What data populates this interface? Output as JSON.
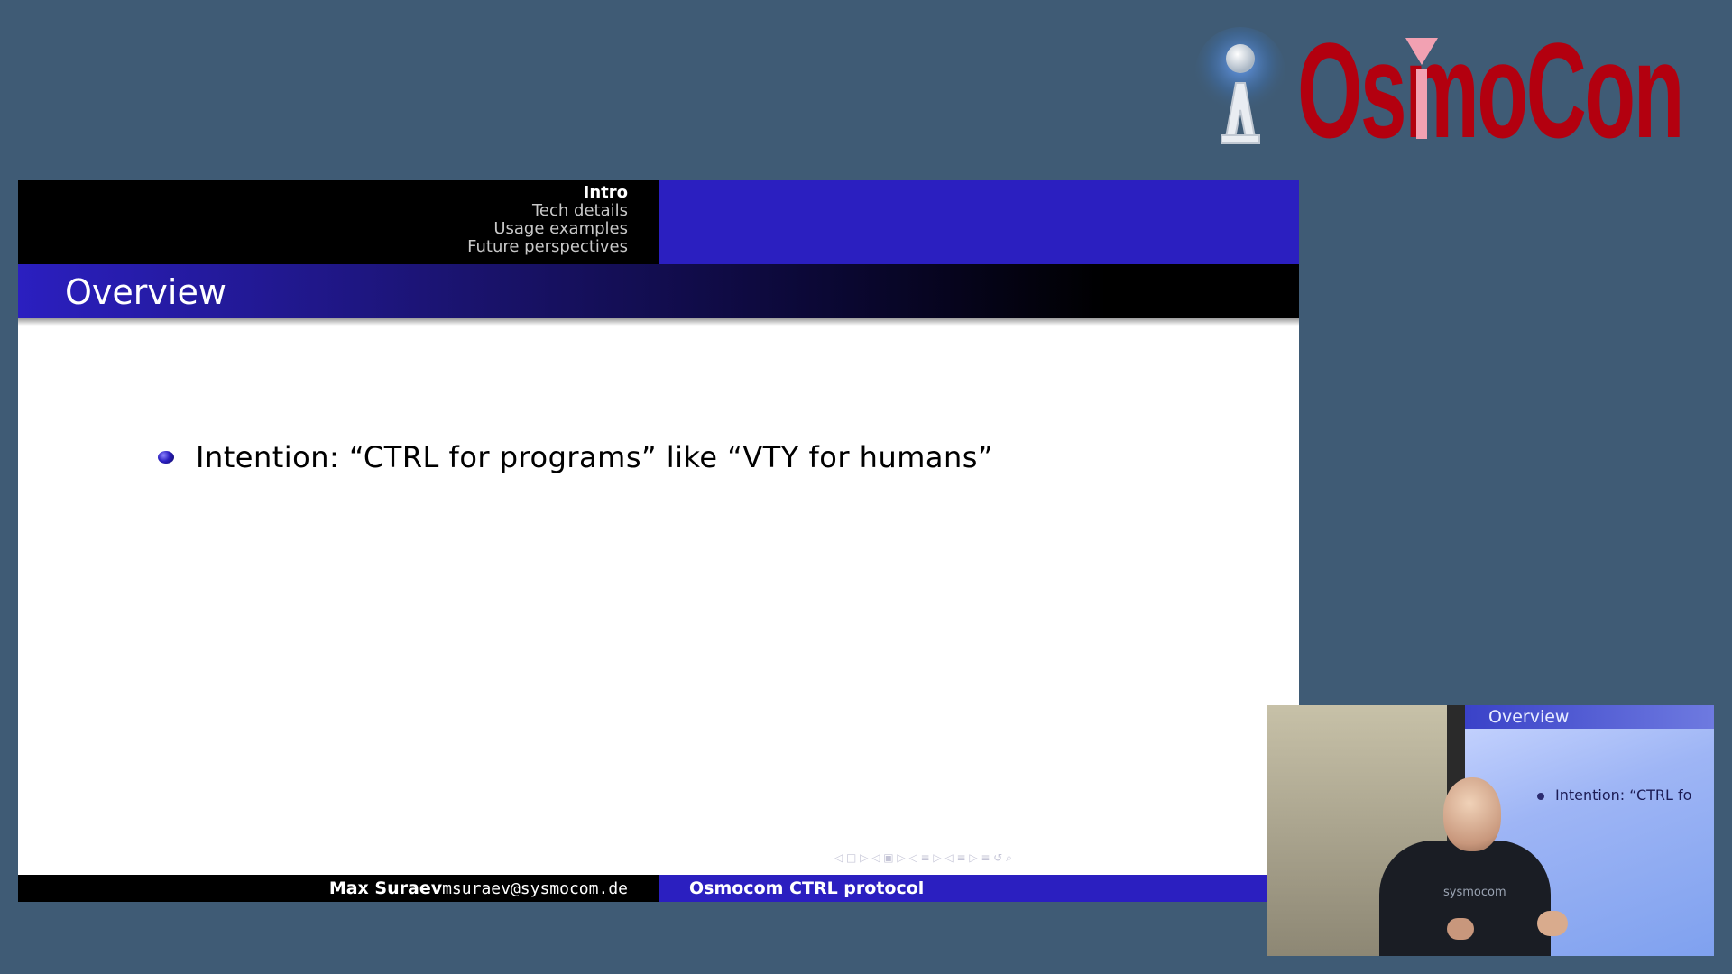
{
  "logo": {
    "text": "OsmoCon",
    "icon": "antenna-tower-icon",
    "color": "#b3000f"
  },
  "slide": {
    "sections": {
      "current": "Intro",
      "others": [
        "Tech details",
        "Usage examples",
        "Future perspectives"
      ]
    },
    "frame_title": "Overview",
    "bullets": [
      "Intention: “CTRL for programs” like “VTY for humans”"
    ],
    "nav_symbols": "◁ □ ▷   ◁ ▣ ▷   ◁ ≡ ▷   ◁ ≡ ▷   ≡   ↺ ⌕",
    "footer": {
      "author_name": "Max Suraev",
      "author_email": "msuraev@sysmocom.de",
      "talk_title": "Osmocom CTRL protocol"
    },
    "colors": {
      "structure_blue": "#2b1fc0",
      "header_black": "#000000",
      "background": "#3f5b75"
    }
  },
  "video": {
    "screen_title": "Overview",
    "screen_bullet": "Intention: “CTRL fo",
    "shirt_text": "sysmocom"
  }
}
